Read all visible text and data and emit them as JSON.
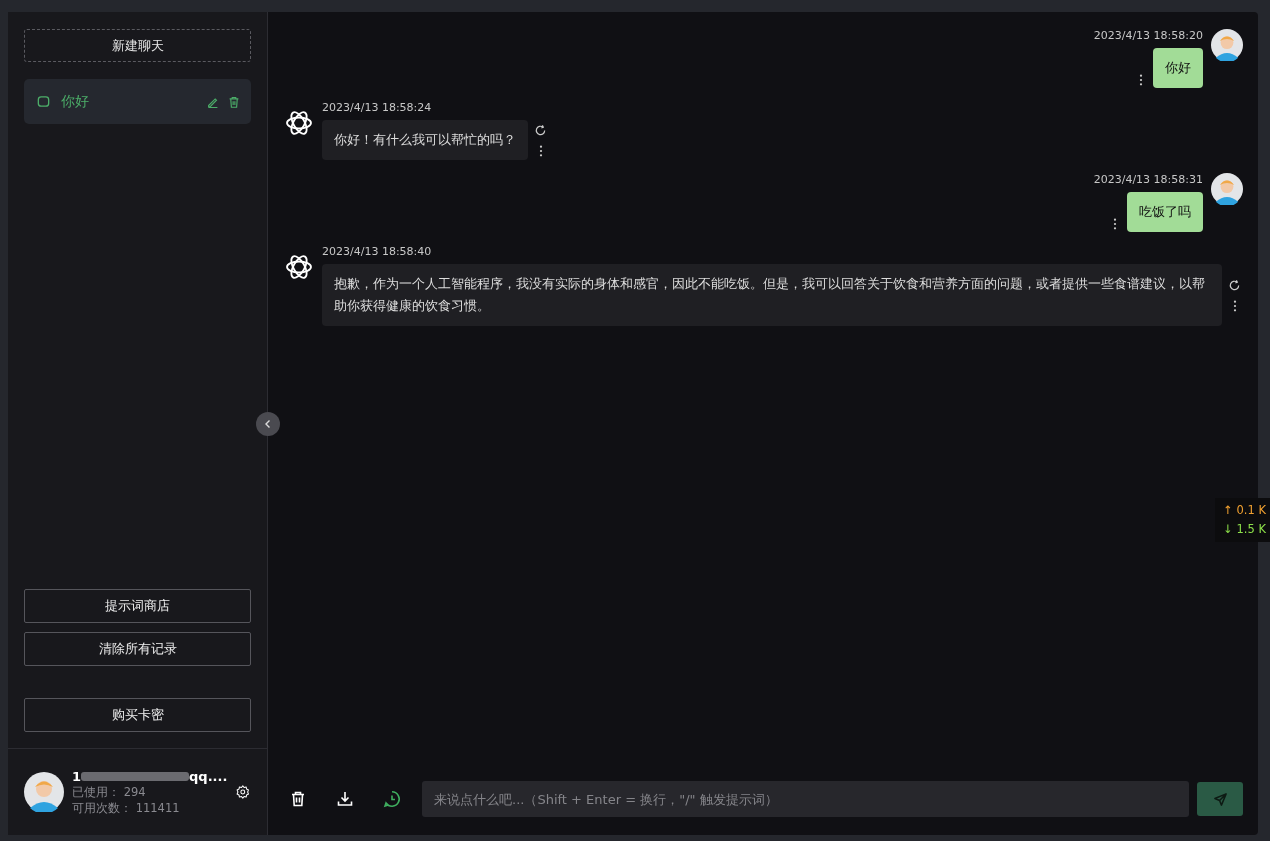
{
  "sidebar": {
    "new_chat_button": "新建聊天",
    "chats": [
      {
        "title": "你好",
        "selected": true
      }
    ],
    "buttons": [
      "提示词商店",
      "清除所有记录",
      "购买卡密"
    ],
    "user": {
      "email_start": "1",
      "email_end": "qq....",
      "used_label": "已使用：",
      "used": "294",
      "remaining_label": "可用次数：",
      "remaining": "111411"
    }
  },
  "messages": [
    {
      "kind": "user",
      "time": "2023/4/13 18:58:20",
      "text": "你好"
    },
    {
      "kind": "assistant",
      "time": "2023/4/13 18:58:24",
      "text": "你好！有什么我可以帮忙的吗？"
    },
    {
      "kind": "user",
      "time": "2023/4/13 18:58:31",
      "text": "吃饭了吗"
    },
    {
      "kind": "assistant",
      "time": "2023/4/13 18:58:40",
      "text": "抱歉，作为一个人工智能程序，我没有实际的身体和感官，因此不能吃饭。但是，我可以回答关于饮食和营养方面的问题，或者提供一些食谱建议，以帮助你获得健康的饮食习惯。"
    }
  ],
  "input": {
    "placeholder": "来说点什么吧...（Shift + Enter = 换行，\"/\" 触发提示词）"
  },
  "net_speed": {
    "up": "↑ 0.1 K",
    "down": "↓ 1.5 K"
  }
}
